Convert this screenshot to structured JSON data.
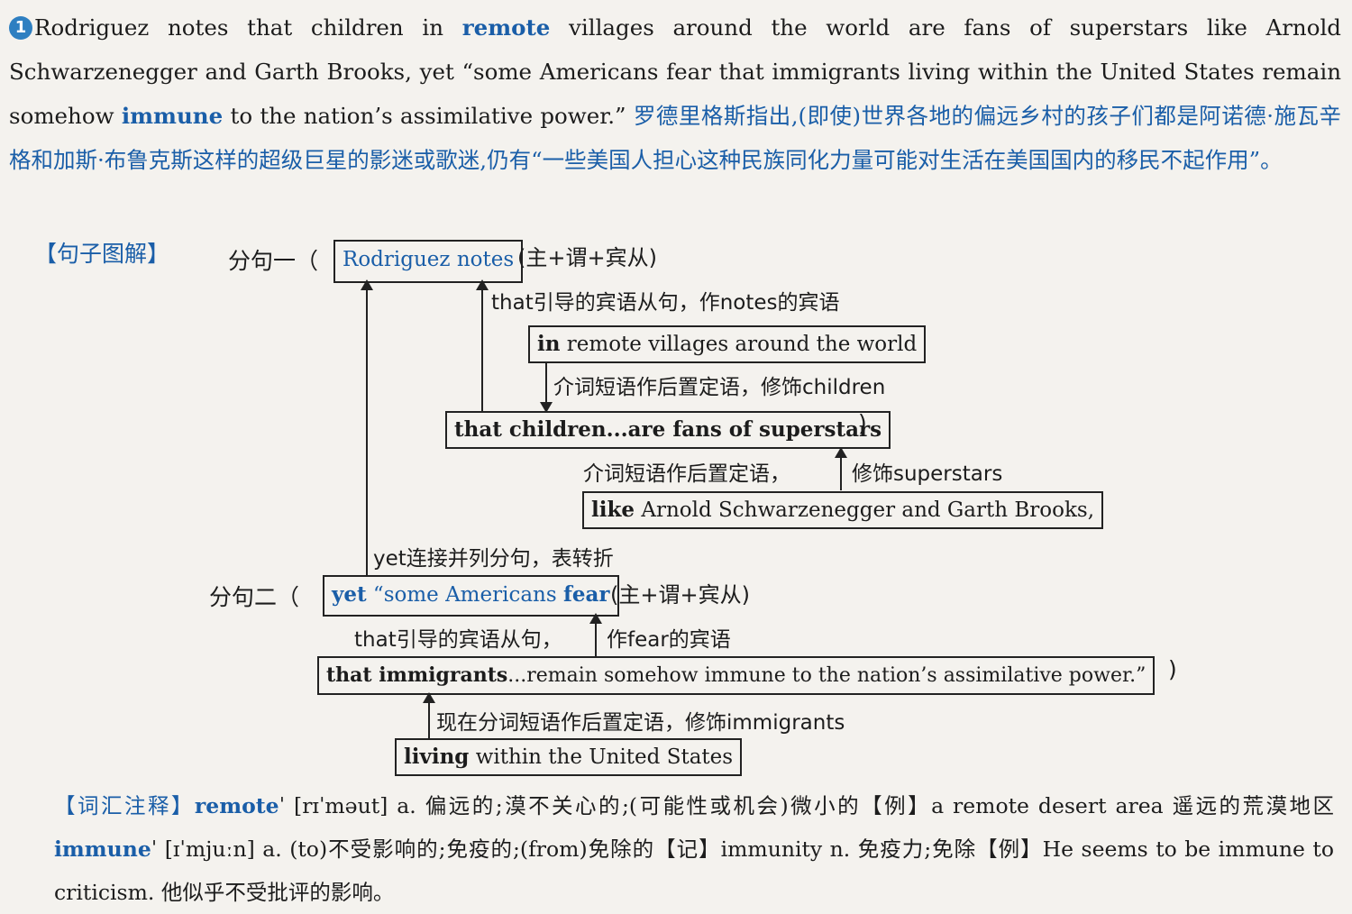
{
  "paragraph": {
    "number": "1",
    "p1": "Rodriguez notes that children in ",
    "remote": "remote",
    "p2": " villages around the world are fans of superstars like Arnold Schwarzenegger and Garth Brooks, yet “some Americans fear that immigrants living within the United States remain somehow ",
    "immune": "immune",
    "p3": " to the nation’s assimilative power.”",
    "translation": "罗德里格斯指出,(即使)世界各地的偏远乡村的孩子们都是阿诺德·施瓦辛格和加斯·布鲁克斯这样的超级巨星的影迷或歌迷,仍有“一些美国人担心这种民族同化力量可能对生活在美国国内的移民不起作用”。"
  },
  "diagram": {
    "title": "【句子图解】",
    "clause1_label": "分句一（",
    "clause1_box": "Rodriguez notes",
    "clause1_note": "(主+谓+宾从)",
    "note_that_obj1": "that引导的宾语从句，作notes的宾语",
    "box_remote_a": "in",
    "box_remote_b": " remote villages around the world",
    "note_prep1": "介词短语作后置定语，修饰children",
    "box_children_a": "that children...are fans of ",
    "box_children_b": "superstars",
    "close_paren1": ")",
    "note_prep2a": "介词短语作后置定语，",
    "note_prep2b": "修饰superstars",
    "box_like_a": "like",
    "box_like_b": " Arnold Schwarzenegger and Garth Brooks,",
    "note_yet": "yet连接并列分句，表转折",
    "clause2_label": "分句二（",
    "clause2_box_a": "yet",
    "clause2_box_b": " “some Americans ",
    "clause2_box_c": "fear",
    "clause2_note": "(主+谓+宾从)",
    "note_that_obj2a": "that引导的宾语从句，",
    "note_that_obj2b": "作fear的宾语",
    "box_immigrants_a": "that immigrants",
    "box_immigrants_b": "...remain somehow immune to the nation’s assimilative power.”",
    "close_paren2": ")",
    "note_participle": "现在分词短语作后置定语，修饰immigrants",
    "box_living_a": "living",
    "box_living_b": " within the United States"
  },
  "vocab": {
    "head": "【词汇注释】",
    "word1": "remote",
    "word1_rest": "ˈ [rɪˈməut] a. 偏远的;漠不关心的;(可能性或机会)微小的【例】a remote desert area 遥远的荒漠地区 ",
    "word2": "immune",
    "word2_rest": "ˈ [ɪˈmjuːn] a. (to)不受影响的;免疫的;(from)免除的【记】immunity n. 免疫力;免除【例】He seems to be immune to criticism. 他似乎不受批评的影响。"
  }
}
